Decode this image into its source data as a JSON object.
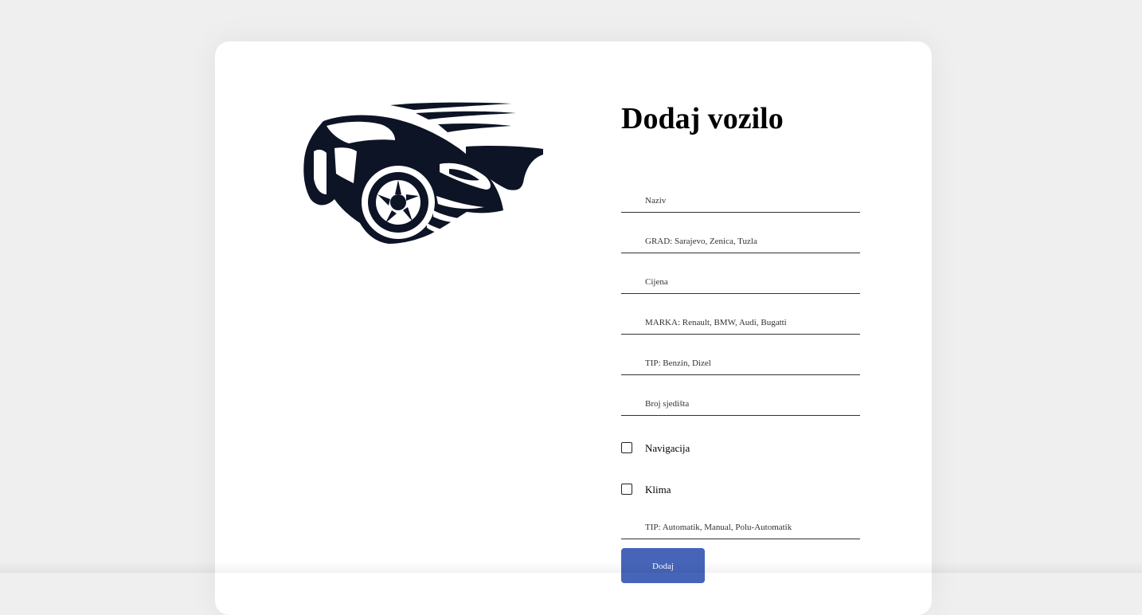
{
  "form": {
    "title": "Dodaj vozilo",
    "fields": {
      "naziv": {
        "placeholder": "Naziv",
        "value": ""
      },
      "grad": {
        "placeholder": "GRAD: Sarajevo, Zenica, Tuzla",
        "value": ""
      },
      "cijena": {
        "placeholder": "Cijena",
        "value": ""
      },
      "marka": {
        "placeholder": "MARKA: Renault, BMW, Audi, Bugatti",
        "value": ""
      },
      "tip_goriva": {
        "placeholder": "TIP: Benzin, Dizel",
        "value": ""
      },
      "broj_sjedista": {
        "placeholder": "Broj sjedišta",
        "value": ""
      },
      "tip_mjenjaca": {
        "placeholder": "TIP: Automatik, Manual, Polu-Automatik",
        "value": ""
      }
    },
    "checkboxes": {
      "navigacija": {
        "label": "Navigacija",
        "checked": false
      },
      "klima": {
        "label": "Klima",
        "checked": false
      }
    },
    "submit_label": "Dodaj"
  },
  "logo": {
    "icon": "sports-car-logo-icon",
    "color": "#0d1426"
  },
  "colors": {
    "background": "#efefef",
    "card": "#ffffff",
    "accent": "#4665b8"
  }
}
